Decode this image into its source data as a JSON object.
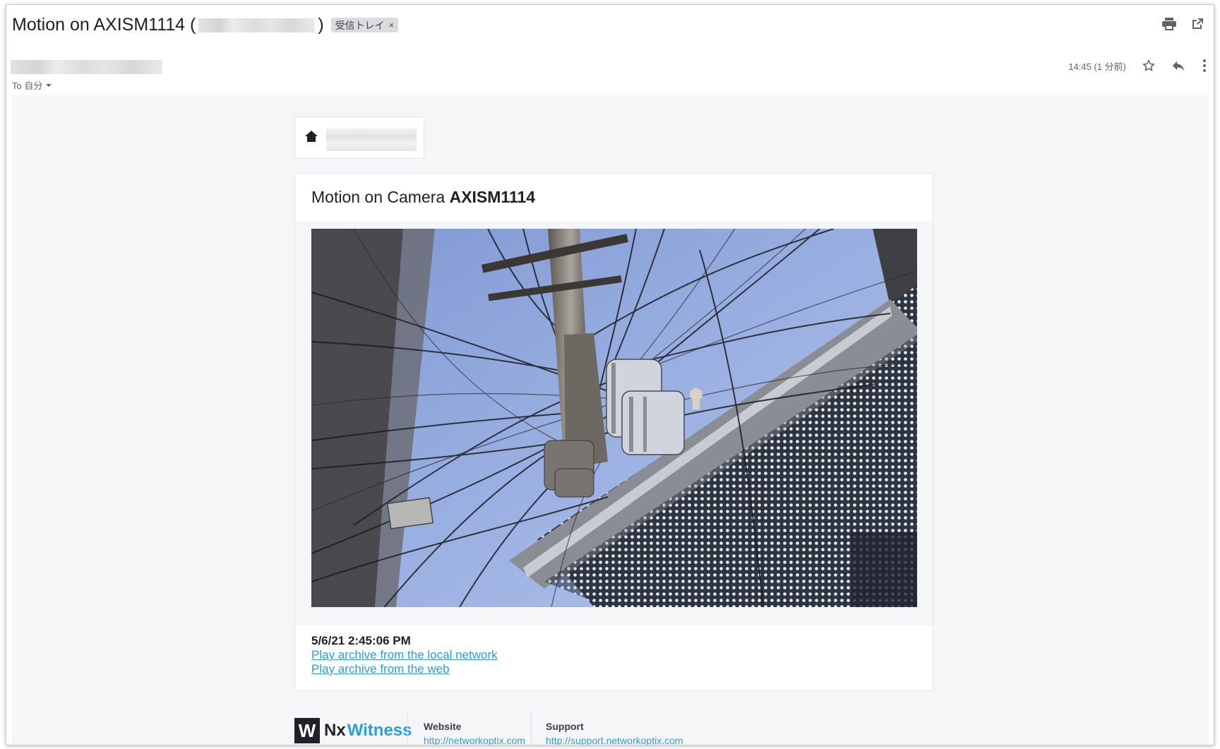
{
  "email": {
    "subject_prefix": "Motion on AXISM1114 (",
    "subject_suffix": ")",
    "label_chip": "受信トレイ",
    "label_close": "×",
    "to_text": "To 自分",
    "time": "14:45 (1 分前)",
    "icons": [
      "print-icon",
      "open-in-new-icon",
      "star-icon",
      "reply-icon",
      "more-vert-icon",
      "chevron-down-icon",
      "home-icon"
    ]
  },
  "card": {
    "title_prefix": "Motion on Camera ",
    "camera_name": "AXISM1114",
    "timestamp": "5/6/21 2:45:06 PM",
    "link_local": "Play archive from the local network",
    "link_web": "Play archive from the web"
  },
  "footer": {
    "logo_letter": "W",
    "logo_nx": "Nx",
    "logo_witness": "Witness",
    "website_label": "Website",
    "website_link": "http://networkoptix.com",
    "support_label": "Support",
    "support_link": "http://support.networkoptix.com"
  },
  "colors": {
    "link": "#2f9bd8",
    "logo_accent": "#2b9fd9",
    "sky": "#8fa7dc"
  }
}
